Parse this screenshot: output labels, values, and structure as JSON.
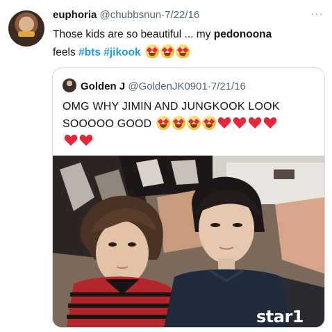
{
  "tweet": {
    "author_name": "euphoria",
    "handle": "@chubbsnun",
    "separator": "·",
    "date": "7/22/16",
    "text_part1": "Those kids are so beautiful ... my ",
    "text_bold": "pedonoona",
    "text_part2": "feels ",
    "hashtag1": "#bts",
    "hashtag2": "#jikook",
    "emojis": [
      "smiling-face-with-heart-eyes",
      "smiling-face-with-heart-eyes",
      "smiling-face-with-heart-eyes"
    ]
  },
  "quote": {
    "author_name": "Golden J",
    "handle": "@GoldenJK0901",
    "separator": "·",
    "date": "7/21/16",
    "text_line1": "OMG WHY JIMIN AND JUNGKOOK LOOK",
    "text_line2": "SOOOOO GOOD",
    "emojis": [
      "smiling-face-with-heart-eyes",
      "smiling-face-with-heart-eyes",
      "smiling-face-with-heart-eyes",
      "smiling-face-with-heart-eyes",
      "red-heart",
      "red-heart",
      "red-heart",
      "red-heart",
      "red-heart",
      "red-heart"
    ],
    "media_watermark": "star1"
  },
  "colors": {
    "link": "#1d9bf0",
    "muted": "#536471",
    "border": "#cfd9de",
    "heart": "#e8263b"
  }
}
